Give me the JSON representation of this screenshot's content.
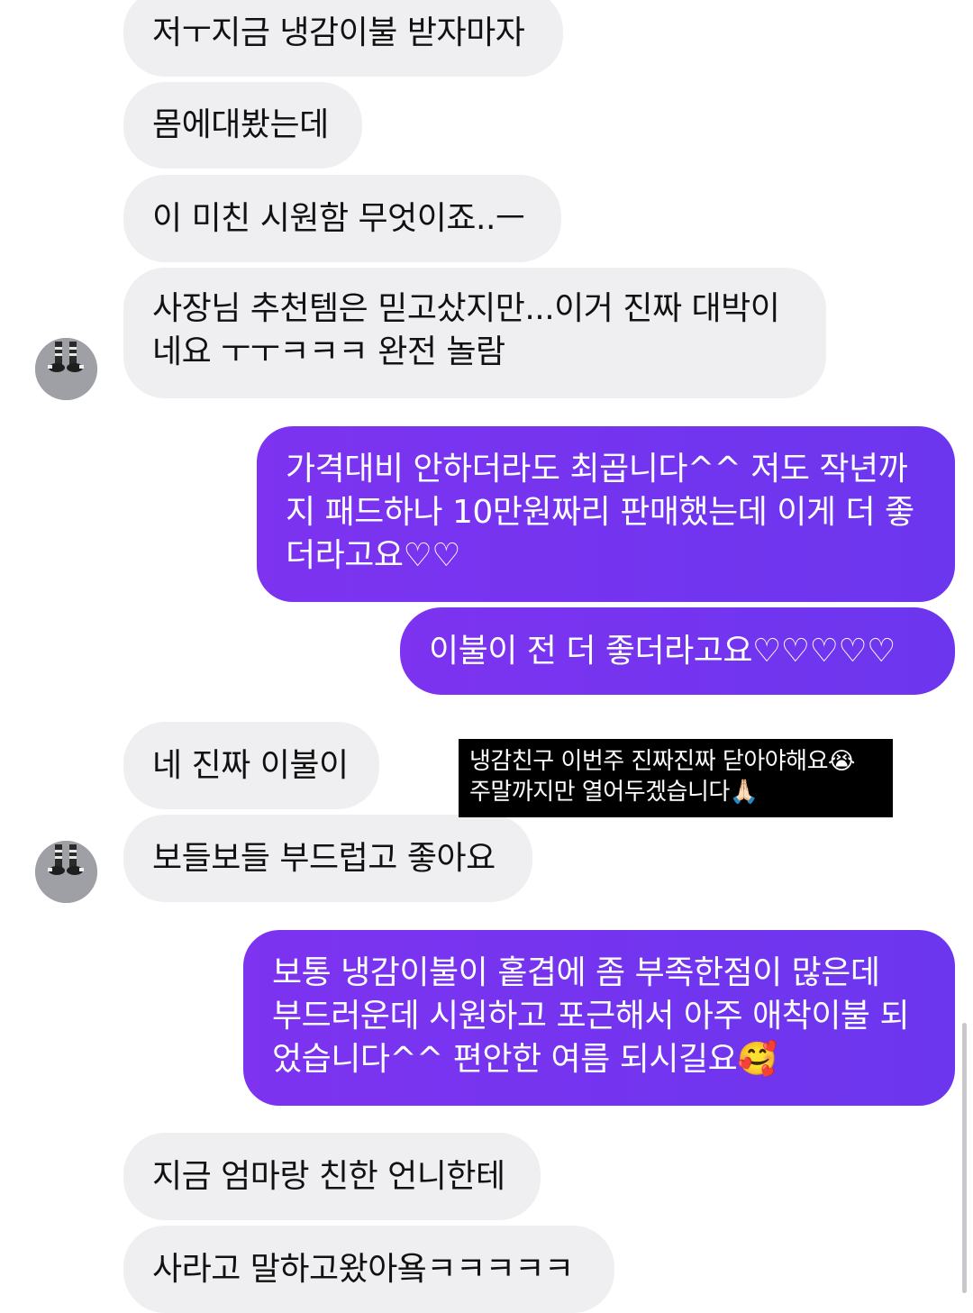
{
  "messages": {
    "m1": "저ㅜ지금 냉감이불 받자마자",
    "m2": "몸에대봤는데",
    "m3": "이 미친 시원함 무엇이죠..ㅡ",
    "m4": {
      "line1": "사장님 추천템은 믿고샀지만...이거 진짜 대박이",
      "line2": "네요 ㅜㅜㅋㅋㅋ 완전 놀람"
    },
    "m5": {
      "line1": "가격대비 안하더라도 최곱니다^^ 저도 작년까",
      "line2": "지 패드하나 10만원짜리 판매했는데 이게 더 좋",
      "line3": "더라고요♡♡"
    },
    "m6": "이불이 전 더 좋더라고요♡♡♡♡♡",
    "m7": "네 진짜 이불이",
    "m8": "보들보들 부드럽고 좋아요",
    "m9": {
      "line1": "보통 냉감이불이 홑겹에 좀 부족한점이 많은데",
      "line2": "부드러운데 시원하고 포근해서 아주 애착이불 되",
      "line3": "었습니다^^ 편안한 여름 되시길요🥰"
    },
    "m10": "지금 엄마랑 친한 언니한테",
    "m11": "사라고 말하고왔아욬ㅋㅋㅋㅋㅋ"
  },
  "overlay": {
    "line1": "냉감친구 이번주 진짜진짜 닫아야해요😭",
    "line2": "주말까지만 열어두겠습니다🙏🏻"
  },
  "colors": {
    "received_bubble": "#efeff1",
    "sent_bubble": "#7434ef",
    "overlay_bg": "#000000"
  },
  "icons": {
    "avatar": "avatar-socks-icon"
  }
}
